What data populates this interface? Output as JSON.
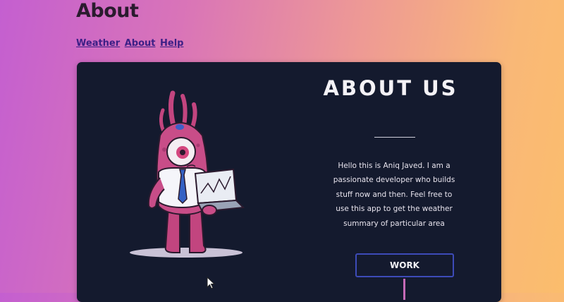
{
  "page": {
    "title": "About"
  },
  "nav": {
    "links": [
      {
        "label": "Weather"
      },
      {
        "label": "About"
      },
      {
        "label": "Help"
      }
    ]
  },
  "card": {
    "heading": "ABOUT US",
    "bio": "Hello this is Aniq Javed. I am a passionate developer who builds stuff now and then. Feel free to use this app to get the weather summary of particular area",
    "button_label": "WORK"
  },
  "icons": {
    "mascot": "monster-with-laptop-illustration",
    "cursor": "mouse-pointer-icon"
  },
  "colors": {
    "card_bg": "#141a2e",
    "link": "#3c1f86",
    "button_border": "#3d4bb8",
    "accent_pink": "#c56ab7"
  }
}
